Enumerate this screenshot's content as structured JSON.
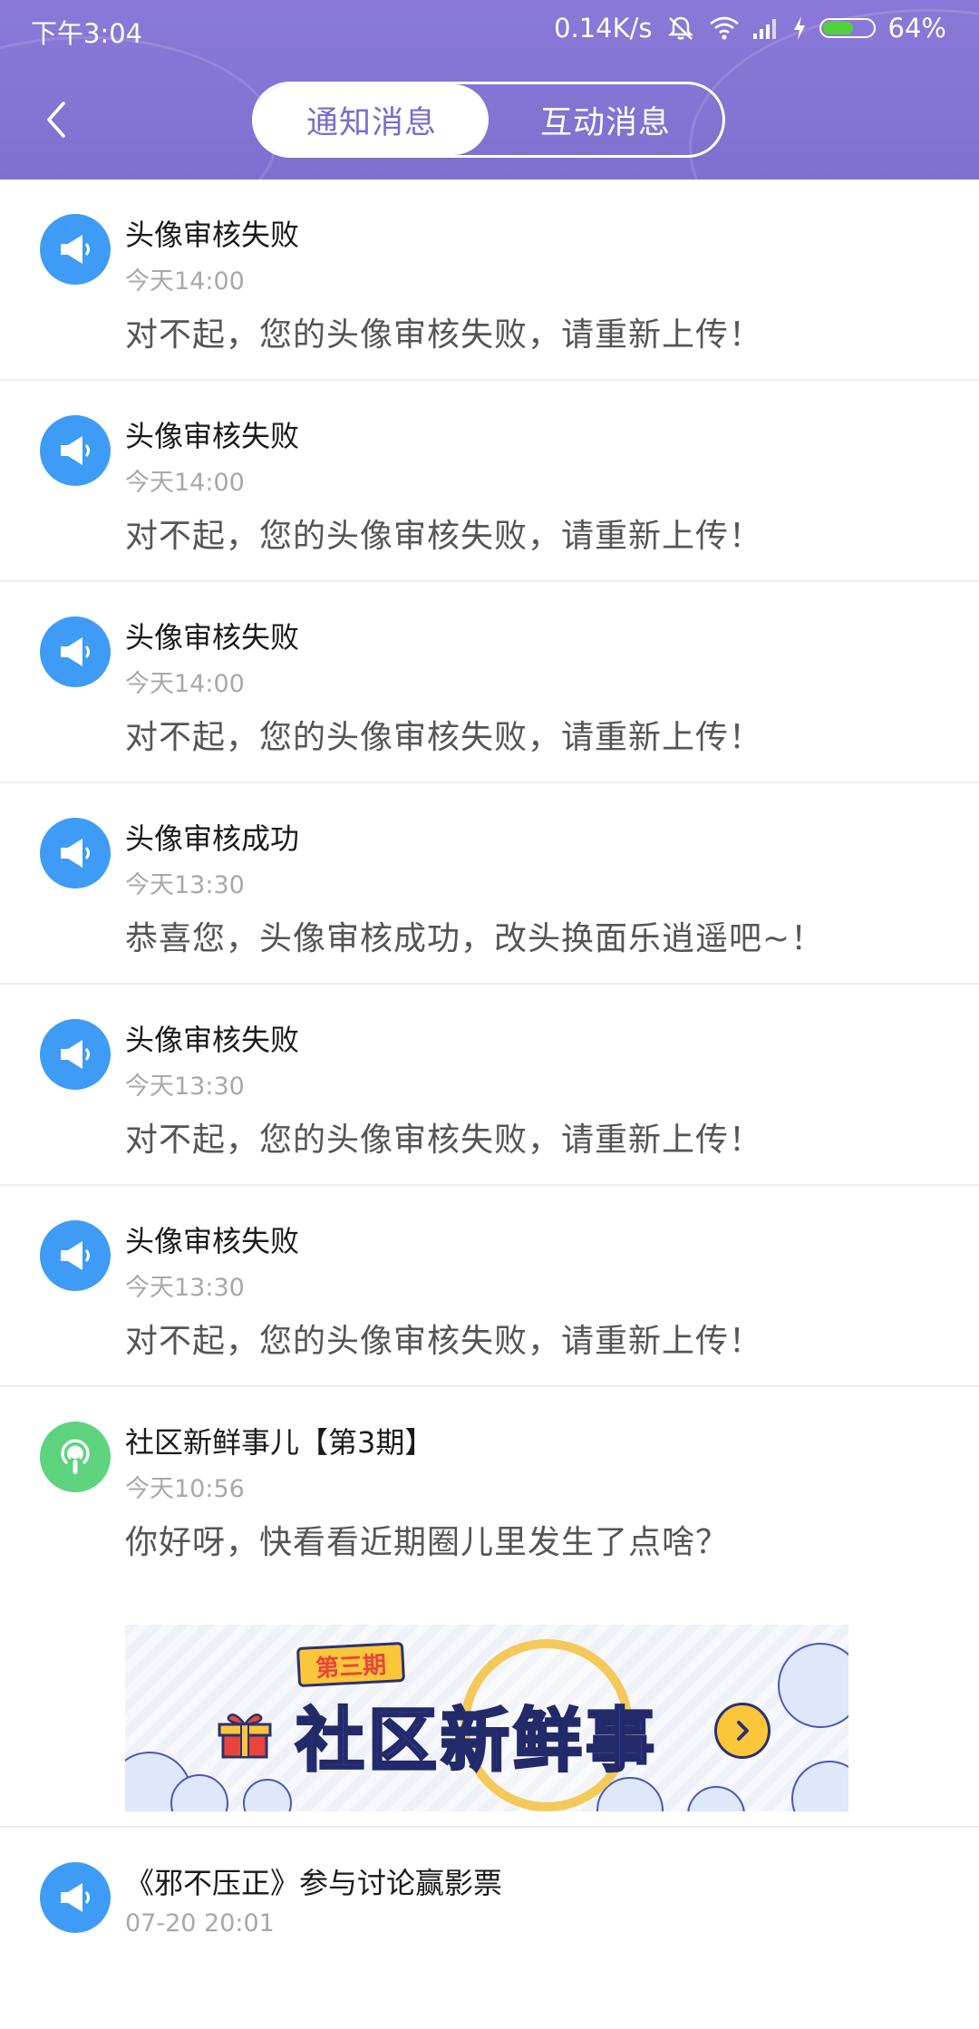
{
  "status_bar": {
    "time": "下午3:04",
    "speed": "0.14K/s",
    "battery": "64%",
    "battery_level": 0.64
  },
  "header": {
    "tabs": [
      {
        "label": "通知消息",
        "active": true
      },
      {
        "label": "互动消息",
        "active": false
      }
    ]
  },
  "colors": {
    "header": "#8a79d8",
    "accent": "#7a6ccc",
    "notice_icon": "#3e9bf6",
    "community_icon": "#5dd37e"
  },
  "messages": [
    {
      "icon": "megaphone-icon",
      "title": "头像审核失败",
      "time": "今天14:00",
      "body": "对不起，您的头像审核失败，请重新上传！"
    },
    {
      "icon": "megaphone-icon",
      "title": "头像审核失败",
      "time": "今天14:00",
      "body": "对不起，您的头像审核失败，请重新上传！"
    },
    {
      "icon": "megaphone-icon",
      "title": "头像审核失败",
      "time": "今天14:00",
      "body": "对不起，您的头像审核失败，请重新上传！"
    },
    {
      "icon": "megaphone-icon",
      "title": "头像审核成功",
      "time": "今天13:30",
      "body": "恭喜您，头像审核成功，改头换面乐逍遥吧~！"
    },
    {
      "icon": "megaphone-icon",
      "title": "头像审核失败",
      "time": "今天13:30",
      "body": "对不起，您的头像审核失败，请重新上传！"
    },
    {
      "icon": "megaphone-icon",
      "title": "头像审核失败",
      "time": "今天13:30",
      "body": "对不起，您的头像审核失败，请重新上传！"
    },
    {
      "icon": "podcast-icon",
      "title": "社区新鲜事儿【第3期】",
      "time": "今天10:56",
      "body": "你好呀，快看看近期圈儿里发生了点啥？",
      "banner": {
        "issue": "第三期",
        "headline": "社区新鲜事"
      }
    },
    {
      "icon": "megaphone-icon",
      "title": "《邪不压正》参与讨论赢影票",
      "time": "07-20 20:01",
      "body": ""
    }
  ]
}
